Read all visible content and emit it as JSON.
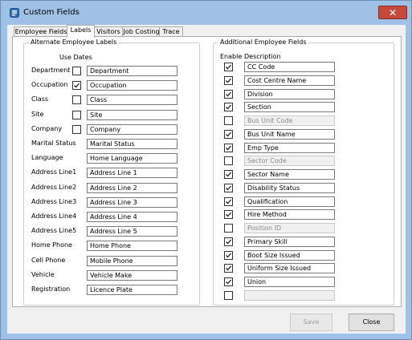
{
  "window": {
    "title": "Custom Fields",
    "close_label": "✕"
  },
  "tabs": [
    {
      "label": "Employee Fields"
    },
    {
      "label": "Labels"
    },
    {
      "label": "Visitors"
    },
    {
      "label": "Job Costing"
    },
    {
      "label": "Trace"
    }
  ],
  "active_tab": "Labels",
  "alternate": {
    "title": "Alternate Employee Labels",
    "use_dates_label": "Use Dates",
    "rows": [
      {
        "label": "Department",
        "checkbox": true,
        "checked": false,
        "value": "Department"
      },
      {
        "label": "Occupation",
        "checkbox": true,
        "checked": true,
        "value": "Occupation"
      },
      {
        "label": "Class",
        "checkbox": true,
        "checked": false,
        "value": "Class"
      },
      {
        "label": "Site",
        "checkbox": true,
        "checked": false,
        "value": "Site"
      },
      {
        "label": "Company",
        "checkbox": true,
        "checked": false,
        "value": "Company"
      },
      {
        "label": "Marital Status",
        "checkbox": false,
        "checked": false,
        "value": "Marital Status"
      },
      {
        "label": "Language",
        "checkbox": false,
        "checked": false,
        "value": "Home Language"
      },
      {
        "label": "Address Line1",
        "checkbox": false,
        "checked": false,
        "value": "Address Line 1"
      },
      {
        "label": "Address Line2",
        "checkbox": false,
        "checked": false,
        "value": "Address Line 2"
      },
      {
        "label": "Address Line3",
        "checkbox": false,
        "checked": false,
        "value": "Address Line 3"
      },
      {
        "label": "Address Line4",
        "checkbox": false,
        "checked": false,
        "value": "Address Line 4"
      },
      {
        "label": "Address Line5",
        "checkbox": false,
        "checked": false,
        "value": "Address Line 5"
      },
      {
        "label": "Home Phone",
        "checkbox": false,
        "checked": false,
        "value": "Home Phone"
      },
      {
        "label": "Cell Phone",
        "checkbox": false,
        "checked": false,
        "value": "Mobile Phone"
      },
      {
        "label": "Vehicle",
        "checkbox": false,
        "checked": false,
        "value": "Vehicle Make"
      },
      {
        "label": "Registration",
        "checkbox": false,
        "checked": false,
        "value": "Licence Plate"
      }
    ]
  },
  "additional": {
    "title": "Additional Employee Fields",
    "enable_header": "Enable",
    "description_header": "Description",
    "rows": [
      {
        "enabled": true,
        "value": "CC Code"
      },
      {
        "enabled": true,
        "value": "Cost Centre Name"
      },
      {
        "enabled": true,
        "value": "Division"
      },
      {
        "enabled": true,
        "value": "Section"
      },
      {
        "enabled": false,
        "value": "Bus Unit Code"
      },
      {
        "enabled": true,
        "value": "Bus Unit Name"
      },
      {
        "enabled": true,
        "value": "Emp Type"
      },
      {
        "enabled": false,
        "value": "Sector Code"
      },
      {
        "enabled": true,
        "value": "Sector Name"
      },
      {
        "enabled": true,
        "value": "Disability Status"
      },
      {
        "enabled": true,
        "value": "Qualification"
      },
      {
        "enabled": true,
        "value": "Hire Method"
      },
      {
        "enabled": false,
        "value": "Position ID"
      },
      {
        "enabled": true,
        "value": "Primary Skill"
      },
      {
        "enabled": true,
        "value": "Boot Size Issued"
      },
      {
        "enabled": true,
        "value": "Uniform Size Issued"
      },
      {
        "enabled": true,
        "value": "Union"
      },
      {
        "enabled": false,
        "value": ""
      }
    ]
  },
  "buttons": {
    "save": "Save",
    "close": "Close"
  },
  "colors": {
    "titlebar": "#9fc1e6",
    "close_button": "#c7493b",
    "client": "#f0f0f0"
  }
}
